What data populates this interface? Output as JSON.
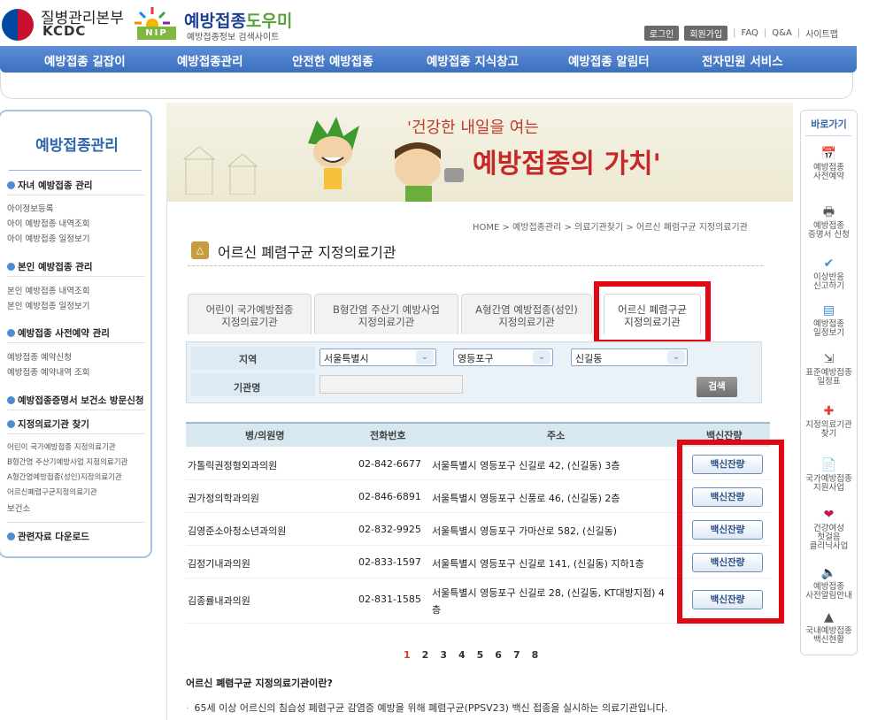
{
  "header": {
    "org_name": "질병관리본부",
    "org_en": "KCDC",
    "nip_badge": "NIP",
    "site_title_a": "예방접종",
    "site_title_b": "도우미",
    "site_sub": "예방접종정보 검색사이트",
    "util": {
      "login": "로그인",
      "join": "회원가입",
      "faq": "FAQ",
      "qna": "Q&A",
      "sitemap": "사이트맵"
    }
  },
  "nav": [
    "예방접종 길잡이",
    "예방접종관리",
    "안전한 예방접종",
    "예방접종 지식창고",
    "예방접종 알림터",
    "전자민원 서비스"
  ],
  "left": {
    "title": "예방접종관리",
    "sections": [
      {
        "head": "자녀 예방접종 관리",
        "items": [
          "아이정보등록",
          "아이 예방접종 내역조회",
          "아이 예방접종 일정보기"
        ]
      },
      {
        "head": "본인 예방접종 관리",
        "items": [
          "본인 예방접종 내역조회",
          "본인 예방접종 일정보기"
        ]
      },
      {
        "head": "예방접종 사전예약 관리",
        "items": [
          "예방접종 예약신청",
          "예방접종 예약내역 조회"
        ]
      },
      {
        "head": "예방접종증명서 보건소 방문신청",
        "items": []
      },
      {
        "head": "지정의료기관 찾기",
        "items": [
          "어린이 국가예방접종 지정의료기관",
          "B형간염 주산기예방사업 지정의료기관",
          "A형간염예방접종(성인)지정의료기관",
          "어르신폐렴구균지정의료기관",
          "보건소"
        ]
      },
      {
        "head": "관련자료 다운로드",
        "items": []
      }
    ]
  },
  "banner": {
    "line1": "'건강한 내일을 여는",
    "line2": "예방접종의 가치'"
  },
  "breadcrumb": "HOME > 예방접종관리 > 의료기관찾기 > 어르신 폐렴구균 지정의료기관",
  "page_title": "어르신 폐렴구균 지정의료기관",
  "tabs": [
    {
      "line1": "어린이 국가예방접종",
      "line2": "지정의료기관"
    },
    {
      "line1": "B형간염 주산기 예방사업",
      "line2": "지정의료기관"
    },
    {
      "line1": "A형간염 예방접종(성인)",
      "line2": "지정의료기관"
    },
    {
      "line1": "어르신 폐렴구균",
      "line2": "지정의료기관"
    }
  ],
  "search": {
    "region_label": "지역",
    "name_label": "기관명",
    "sido": "서울특별시",
    "sigungu": "영등포구",
    "dong": "신길동",
    "name_value": "",
    "button": "검색"
  },
  "table": {
    "headers": [
      "병/의원명",
      "전화번호",
      "주소",
      "백신잔량"
    ],
    "rows": [
      {
        "name": "가톨릭권정형외과의원",
        "phone": "02-842-6677",
        "addr1": "서울특별시 영등포구 신길로 42, (신길동) 3층",
        "addr2": "",
        "btn": "백신잔량"
      },
      {
        "name": "권가정의학과의원",
        "phone": "02-846-6891",
        "addr1": "서울특별시 영등포구 신풍로 46, (신길동) 2층",
        "addr2": "",
        "btn": "백신잔량"
      },
      {
        "name": "김영준소아청소년과의원",
        "phone": "02-832-9925",
        "addr1": "서울특별시 영등포구 가마산로 582, (신길동)",
        "addr2": "",
        "btn": "백신잔량"
      },
      {
        "name": "김정기내과의원",
        "phone": "02-833-1597",
        "addr1": "서울특별시 영등포구 신길로 141, (신길동) 지하1층",
        "addr2": "",
        "btn": "백신잔량"
      },
      {
        "name": "김종률내과의원",
        "phone": "02-831-1585",
        "addr1": "서울특별시 영등포구 신길로 28, (신길동, KT대방지점) 4",
        "addr2": "층",
        "btn": "백신잔량"
      }
    ]
  },
  "pagination": {
    "current": "1",
    "pages": [
      "2",
      "3",
      "4",
      "5",
      "6",
      "7",
      "8"
    ]
  },
  "info": {
    "title": "어르신 폐렴구균 지정의료기관이란?",
    "text": "65세 이상 어르신의 침습성 폐렴구균 감염증 예방을 위해 폐렴구균(PPSV23) 백신 접종을 실시하는 의료기관입니다."
  },
  "quick": {
    "title": "바로가기",
    "items": [
      {
        "icon": "calendar-icon",
        "line1": "예방접종",
        "line2": "사전예약",
        "line3": ""
      },
      {
        "icon": "printer-icon",
        "line1": "예방접종",
        "line2": "증명서 신청",
        "line3": ""
      },
      {
        "icon": "check-icon",
        "line1": "이상반응",
        "line2": "신고하기",
        "line3": ""
      },
      {
        "icon": "schedule-icon",
        "line1": "예방접종",
        "line2": "일정보기",
        "line3": ""
      },
      {
        "icon": "syringe-icon",
        "line1": "표준예방접종",
        "line2": "일정표",
        "line3": ""
      },
      {
        "icon": "hospital-icon",
        "line1": "지정의료기관",
        "line2": "찾기",
        "line3": ""
      },
      {
        "icon": "document-icon",
        "line1": "국가예방접종",
        "line2": "지원사업",
        "line3": ""
      },
      {
        "icon": "health-icon",
        "line1": "건강여성",
        "line2": "첫걸음",
        "line3": "클리닉사업"
      },
      {
        "icon": "speaker-icon",
        "line1": "예방접종",
        "line2": "사전알림안내",
        "line3": ""
      },
      {
        "icon": "vaccine-icon",
        "line1": "국내예방접종",
        "line2": "백신현황",
        "line3": ""
      }
    ]
  },
  "colors": {
    "nav": "#4a7cc9",
    "highlight": "#e30613",
    "table_head": "#d7e8f0",
    "current_page": "#e03a1e"
  }
}
